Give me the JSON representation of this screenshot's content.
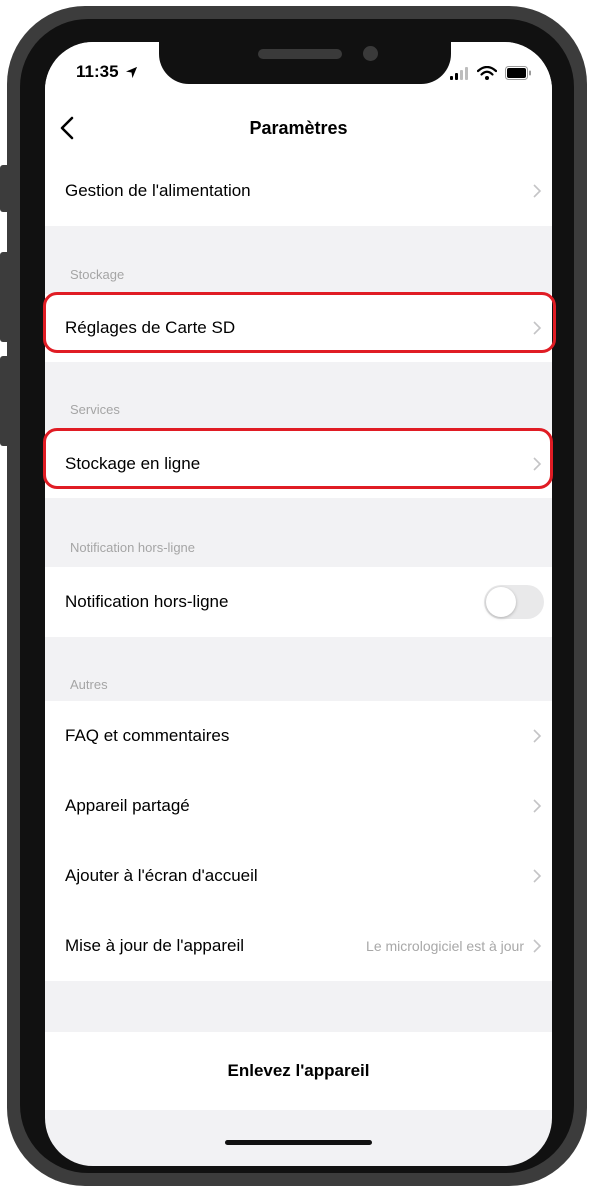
{
  "status_bar": {
    "time": "11:35"
  },
  "nav": {
    "title": "Paramètres",
    "back_icon": "chevron-left-icon"
  },
  "rows": {
    "power": "Gestion de l'alimentation",
    "sd": "Réglages de Carte SD",
    "cloud": "Stockage en ligne",
    "offline_notification": "Notification hors-ligne",
    "faq": "FAQ et commentaires",
    "shared": "Appareil partagé",
    "home_screen": "Ajouter à l'écran d'accueil",
    "update": "Mise à jour de l'appareil",
    "update_status": "Le micrologiciel est à jour"
  },
  "sections": {
    "storage": "Stockage",
    "services": "Services",
    "offline": "Notification hors-ligne",
    "others": "Autres"
  },
  "toggles": {
    "offline_notification_on": false
  },
  "remove_button": "Enlevez l'appareil",
  "colors": {
    "highlight": "#e01c24",
    "background": "#f2f2f4"
  }
}
